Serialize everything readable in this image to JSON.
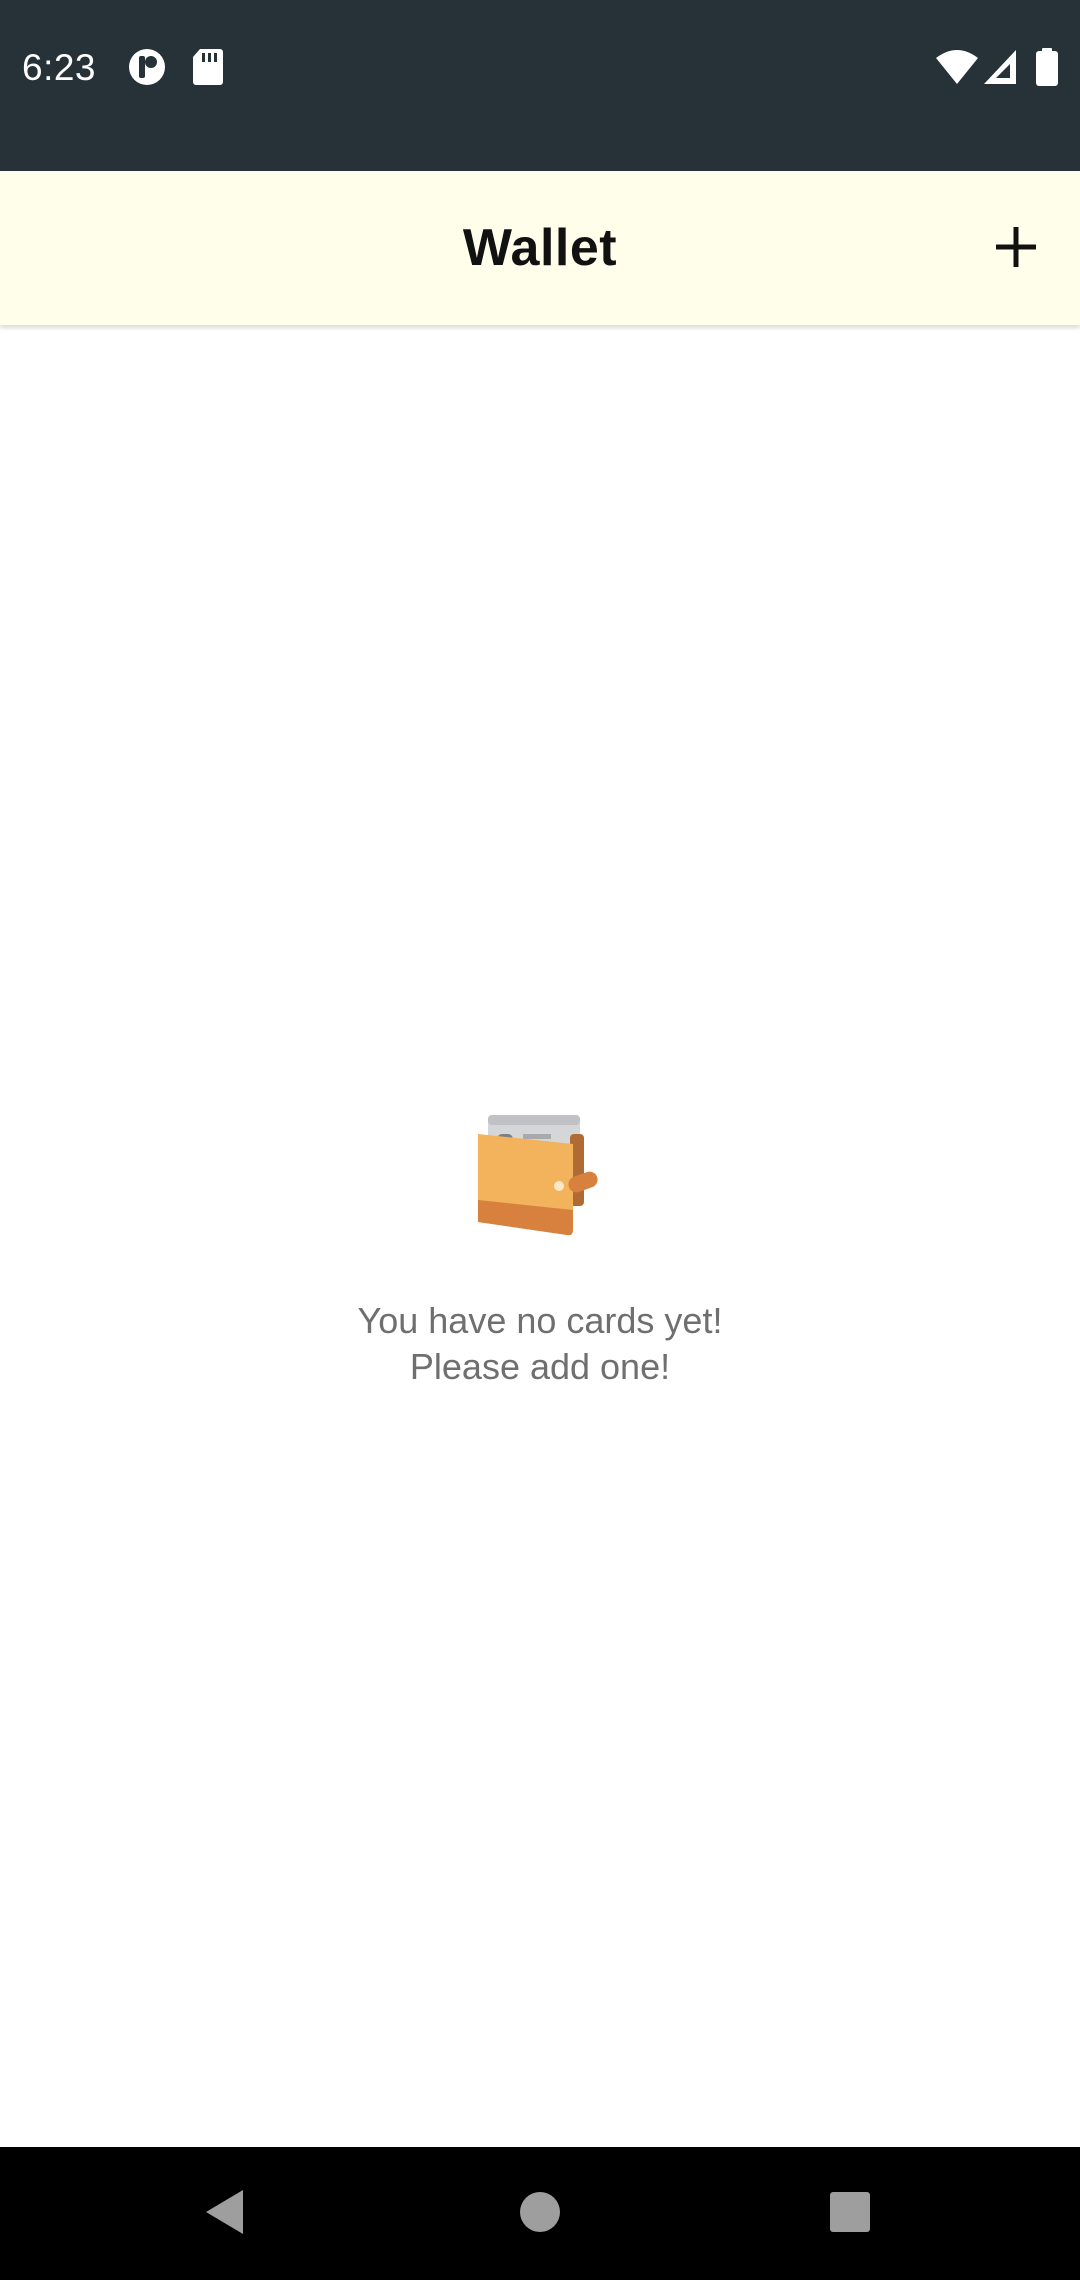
{
  "status_bar": {
    "time": "6:23",
    "left_icons": [
      "notification-app-icon",
      "sd-card-icon"
    ],
    "right_icons": [
      "wifi-icon",
      "cell-signal-icon",
      "battery-icon"
    ],
    "background": "#263238"
  },
  "app_bar": {
    "title": "Wallet",
    "action_icon": "plus-icon",
    "background": "#fefeeb"
  },
  "empty_state": {
    "illustration": "wallet-icon",
    "line1": "You have no cards yet!",
    "line2": "Please add one!"
  },
  "nav_bar": {
    "buttons": [
      "back-icon",
      "home-icon",
      "recents-icon"
    ]
  }
}
